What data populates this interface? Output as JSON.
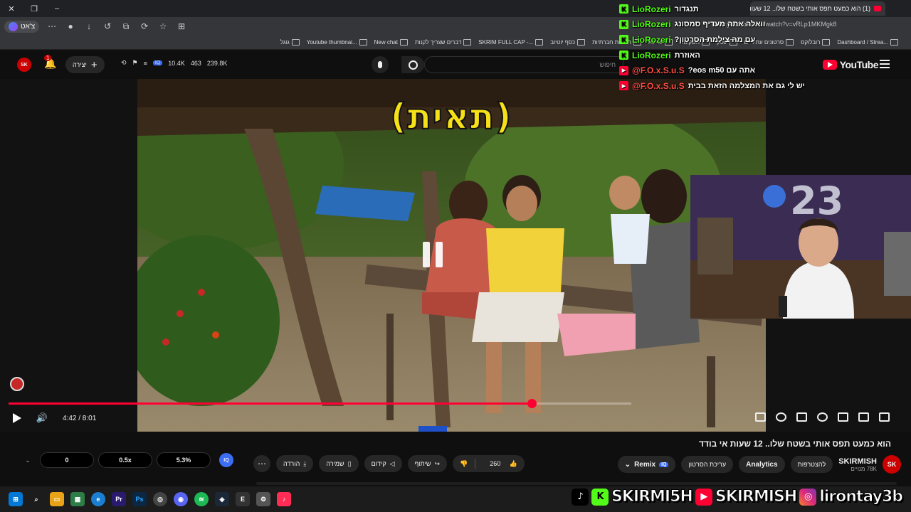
{
  "browser": {
    "tab_title": "(1) הוא כמעט תפס אותי בשטח שלו.. 12 שעות אי בודד",
    "url": "www.youtube.com/watch?v=vRLp1MKMgk8",
    "profile_label": "צ'אט",
    "bookmarks": [
      "Dashboard / Strea...",
      "רובלוקס",
      "סרטונים עתידיים",
      "עסק",
      "השקעות",
      "עריכה",
      "רשתות חברתיות",
      "כסף יוטיוב",
      "SKRIM FULL CAP -...",
      "דברים שצריך לקנות",
      "New chat",
      "Youtube thumbnai...",
      "גוגל"
    ]
  },
  "topbar": {
    "stats": [
      "10.4K",
      "463",
      "239.8K"
    ],
    "create_label": "יצירה",
    "notification_count": "1",
    "search_placeholder": "חיפוש",
    "logo_text": "YouTube",
    "avatar_text": "SK"
  },
  "video": {
    "caption": "(תאית)",
    "current_time": "4:42",
    "duration": "8:01",
    "time_display": "4:42 / 8:01",
    "progress_fraction": 0.84,
    "buffered_fraction": 1.0
  },
  "chat": [
    {
      "platform": "kick",
      "name": "LioRozeri",
      "message": "תנגדור"
    },
    {
      "platform": "kick",
      "name": "LioRozeri",
      "message": "וואלה אתה מעדיף סמסונג"
    },
    {
      "platform": "kick",
      "name": "LioRozeri",
      "message": "עם מה צילמת הסרטון?"
    },
    {
      "platform": "kick",
      "name": "LioRozeri",
      "message": "האוזרת"
    },
    {
      "platform": "yt",
      "name": "@F.O.x.S.u.S",
      "message": "אתה עם eos m50?"
    },
    {
      "platform": "yt",
      "name": "@F.O.x.S.u.S",
      "message": "יש לי גם את המצלמה הזאת בבית"
    }
  ],
  "below_video": {
    "title": "הוא כמעט תפס אותי בשטח שלו.. 12 שעות אי בודד",
    "channel_name": "SKIRMISH",
    "subscribers": "78K מנויים",
    "buttons": {
      "customize": "להצטרפות",
      "analytics": "Analytics",
      "edit": "עריכת הסרטון",
      "remix": "Remix",
      "likes": "260",
      "share": "שיתוף",
      "promote": "קידום",
      "save": "שמירה",
      "download": "הורדה"
    }
  },
  "speed_panel": {
    "value_1": "0",
    "value_2": "0.5x",
    "value_3": "5.3%",
    "badge": "IQ"
  },
  "social_overlay": {
    "handles": [
      "SKIRMI5H",
      "SKIRMISH",
      "lirontay3b"
    ]
  },
  "colors": {
    "accent": "#ff0033",
    "kick": "#53fc18",
    "caption": "#f6e017"
  }
}
